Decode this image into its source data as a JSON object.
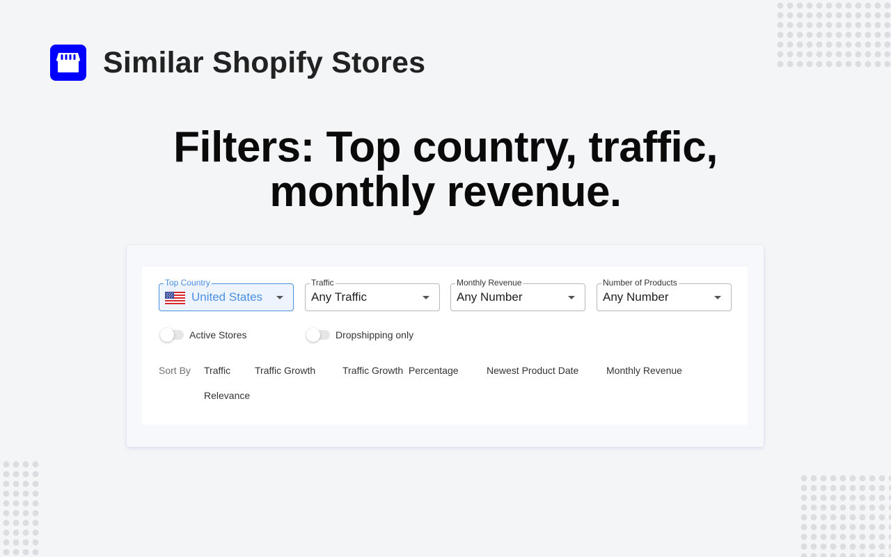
{
  "brand": {
    "title": "Similar Shopify Stores",
    "logo_icon": "storefront-icon",
    "accent_color": "#0000ff"
  },
  "headline": {
    "line1": "Filters: Top country, traffic,",
    "line2": "monthly revenue."
  },
  "filters": {
    "fields": [
      {
        "label": "Top Country",
        "value": "United States",
        "icon": "us-flag-icon",
        "active": true
      },
      {
        "label": "Traffic",
        "value": "Any Traffic",
        "active": false
      },
      {
        "label": "Monthly Revenue",
        "value": "Any Number",
        "active": false
      },
      {
        "label": "Number of Products",
        "value": "Any Number",
        "active": false
      }
    ],
    "toggles": [
      {
        "label": "Active Stores",
        "on": false
      },
      {
        "label": "Dropshipping only",
        "on": false
      }
    ],
    "sort": {
      "label": "Sort By",
      "options": [
        "Traffic",
        "Traffic Growth",
        "Traffic Growth  Percentage",
        "Newest Product Date",
        "Monthly Revenue",
        "Relevance"
      ]
    },
    "active_color": "#4a90e2"
  }
}
